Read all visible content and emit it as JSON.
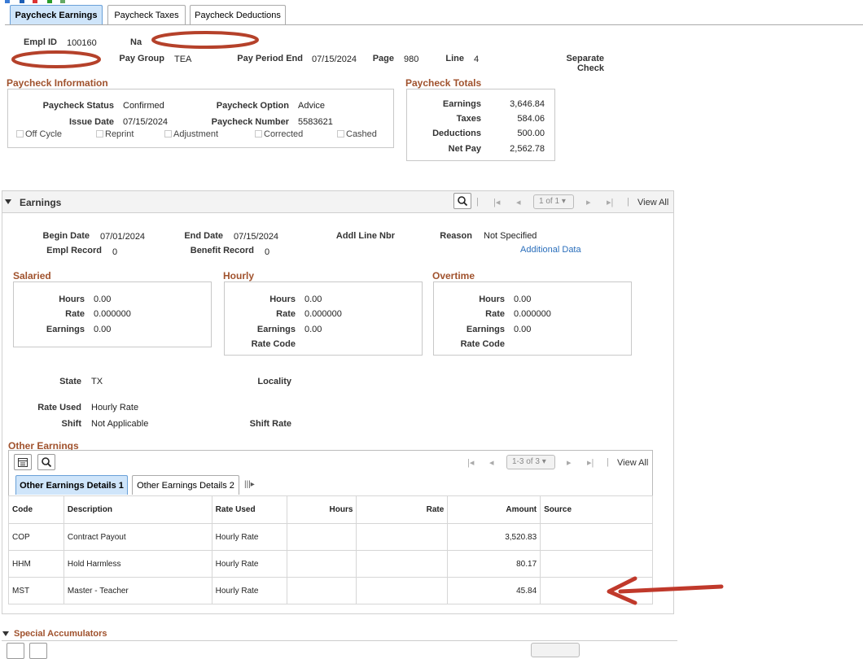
{
  "tabs": [
    {
      "label": "Paycheck Earnings",
      "active": true
    },
    {
      "label": "Paycheck Taxes",
      "active": false
    },
    {
      "label": "Paycheck Deductions",
      "active": false
    }
  ],
  "header": {
    "empl_id_label": "Empl ID",
    "empl_id": "100160",
    "name_label": "Na",
    "pay_group_label": "Pay Group",
    "pay_group": "TEA",
    "pay_period_end_label": "Pay Period End",
    "pay_period_end": "07/15/2024",
    "page_label": "Page",
    "page": "980",
    "line_label": "Line",
    "line": "4",
    "separate_check": "Separate Check"
  },
  "paycheck_info": {
    "title": "Paycheck Information",
    "status_label": "Paycheck Status",
    "status": "Confirmed",
    "option_label": "Paycheck Option",
    "option": "Advice",
    "issue_date_label": "Issue Date",
    "issue_date": "07/15/2024",
    "number_label": "Paycheck Number",
    "number": "5583621",
    "checkboxes": [
      "Off Cycle",
      "Reprint",
      "Adjustment",
      "Corrected",
      "Cashed"
    ]
  },
  "totals": {
    "title": "Paycheck Totals",
    "earnings_label": "Earnings",
    "earnings": "3,646.84",
    "taxes_label": "Taxes",
    "taxes": "584.06",
    "deductions_label": "Deductions",
    "deductions": "500.00",
    "net_label": "Net Pay",
    "net": "2,562.78"
  },
  "earnings": {
    "title": "Earnings",
    "pager": "1 of 1",
    "view_all": "View All",
    "begin_date_label": "Begin Date",
    "begin_date": "07/01/2024",
    "end_date_label": "End Date",
    "end_date": "07/15/2024",
    "addl_line_label": "Addl Line Nbr",
    "reason_label": "Reason",
    "reason": "Not Specified",
    "additional_data": "Additional Data",
    "empl_record_label": "Empl Record",
    "empl_record": "0",
    "benefit_record_label": "Benefit Record",
    "benefit_record": "0",
    "salaried": {
      "title": "Salaried",
      "hours_label": "Hours",
      "hours": "0.00",
      "rate_label": "Rate",
      "rate": "0.000000",
      "earnings_label": "Earnings",
      "earnings": "0.00"
    },
    "hourly": {
      "title": "Hourly",
      "hours_label": "Hours",
      "hours": "0.00",
      "rate_label": "Rate",
      "rate": "0.000000",
      "earnings_label": "Earnings",
      "earnings": "0.00",
      "rate_code_label": "Rate Code"
    },
    "overtime": {
      "title": "Overtime",
      "hours_label": "Hours",
      "hours": "0.00",
      "rate_label": "Rate",
      "rate": "0.000000",
      "earnings_label": "Earnings",
      "earnings": "0.00",
      "rate_code_label": "Rate Code"
    },
    "state_label": "State",
    "state": "TX",
    "locality_label": "Locality",
    "rate_used_label": "Rate Used",
    "rate_used": "Hourly Rate",
    "shift_label": "Shift",
    "shift": "Not Applicable",
    "shift_rate_label": "Shift Rate"
  },
  "other_earnings": {
    "title": "Other Earnings",
    "pager": "1-3 of 3",
    "view_all": "View All",
    "subtabs": [
      {
        "label": "Other Earnings Details 1",
        "active": true
      },
      {
        "label": "Other Earnings Details 2",
        "active": false
      }
    ],
    "columns": [
      "Code",
      "Description",
      "Rate Used",
      "Hours",
      "Rate",
      "Amount",
      "Source"
    ],
    "rows": [
      {
        "code": "COP",
        "description": "Contract Payout",
        "rate_used": "Hourly Rate",
        "hours": "",
        "rate": "",
        "amount": "3,520.83",
        "source": ""
      },
      {
        "code": "HHM",
        "description": "Hold Harmless",
        "rate_used": "Hourly Rate",
        "hours": "",
        "rate": "",
        "amount": "80.17",
        "source": ""
      },
      {
        "code": "MST",
        "description": "Master - Teacher",
        "rate_used": "Hourly Rate",
        "hours": "",
        "rate": "",
        "amount": "45.84",
        "source": ""
      }
    ]
  },
  "special_accumulators": {
    "title": "Special Accumulators"
  },
  "annotation_colors": {
    "redaction": "#b5412a",
    "arrow": "#c0392b"
  }
}
